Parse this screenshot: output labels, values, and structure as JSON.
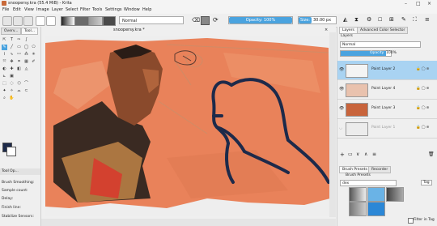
{
  "window": {
    "title": "snoopersy.kra (55.4 MiB) - Krita",
    "controls": [
      "–",
      "□",
      "×"
    ]
  },
  "menu": [
    "File",
    "Edit",
    "View",
    "Image",
    "Layer",
    "Select",
    "Filter",
    "Tools",
    "Settings",
    "Window",
    "Help"
  ],
  "toolbar": {
    "blend_mode": "Normal",
    "opacity_label": "Opacity: 100%",
    "size_label": "Size:",
    "size_value": "30.00 px"
  },
  "left_dock": {
    "tabs": [
      "Overv...",
      "Tool..."
    ],
    "tool_options_title": "Tool Op...",
    "options": [
      "Brush Smoothing:",
      "Sample count:",
      "Delay:",
      "Finish line:",
      "Stabilize Sensors:"
    ]
  },
  "document": {
    "tab_title": "snoopersy.kra *"
  },
  "right_dock": {
    "tabs": [
      "Layers",
      "Advanced Color Selector"
    ],
    "layers_title": "Layers",
    "blend_mode": "Normal",
    "opacity_label": "Opacity",
    "opacity_value": "100%",
    "layers": [
      {
        "name": "Paint Layer 2",
        "active": true,
        "faded": false
      },
      {
        "name": "Paint Layer 4",
        "active": false,
        "faded": false
      },
      {
        "name": "Paint Layer 3",
        "active": false,
        "faded": false
      },
      {
        "name": "Paint Layer 1",
        "active": false,
        "faded": true
      }
    ],
    "bottom_tabs": [
      "Brush Presets",
      "Recorder"
    ],
    "brush_presets_title": "Brush Presets",
    "brush_filter": "dex",
    "tag_label": "Tag",
    "filter_in_tag": "Filter in Tag"
  },
  "colors": {
    "accent": "#4aa3df",
    "canvas_bg": "#e9825a",
    "sketch": "#1d2a4a"
  }
}
